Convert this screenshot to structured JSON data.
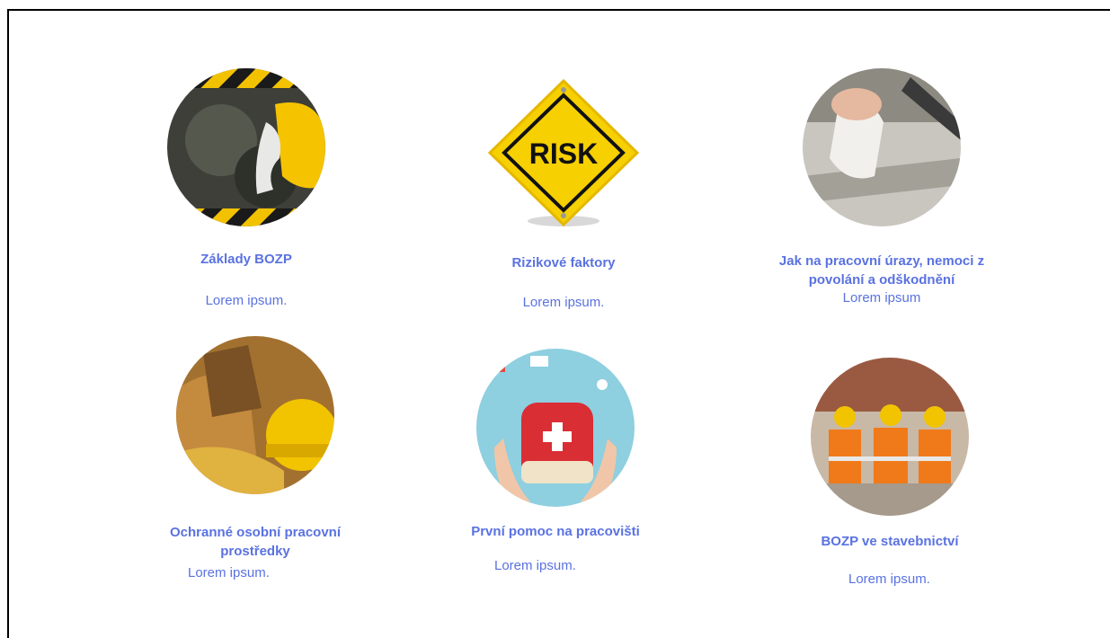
{
  "cards": [
    {
      "title": "Základy BOZP",
      "desc": "Lorem ipsum.",
      "icon": "hardhat-hazard-icon"
    },
    {
      "title": "Rizikové faktory",
      "desc": "Lorem ipsum.",
      "icon": "risk-sign-icon",
      "sign_text": "RISK"
    },
    {
      "title": "Jak na pracovní úrazy, nemoci z povolání a odškodnění",
      "desc": "Lorem ipsum",
      "icon": "injured-foot-icon"
    },
    {
      "title": "Ochranné osobní pracovní prostředky",
      "desc": "Lorem ipsum.",
      "icon": "protective-equipment-icon"
    },
    {
      "title": "První pomoc na pracovišti",
      "desc": "Lorem ipsum.",
      "icon": "first-aid-kit-icon"
    },
    {
      "title": "BOZP ve stavebnictví",
      "desc": "Lorem ipsum.",
      "icon": "construction-workers-icon"
    }
  ],
  "colors": {
    "link": "#5a72e0"
  }
}
